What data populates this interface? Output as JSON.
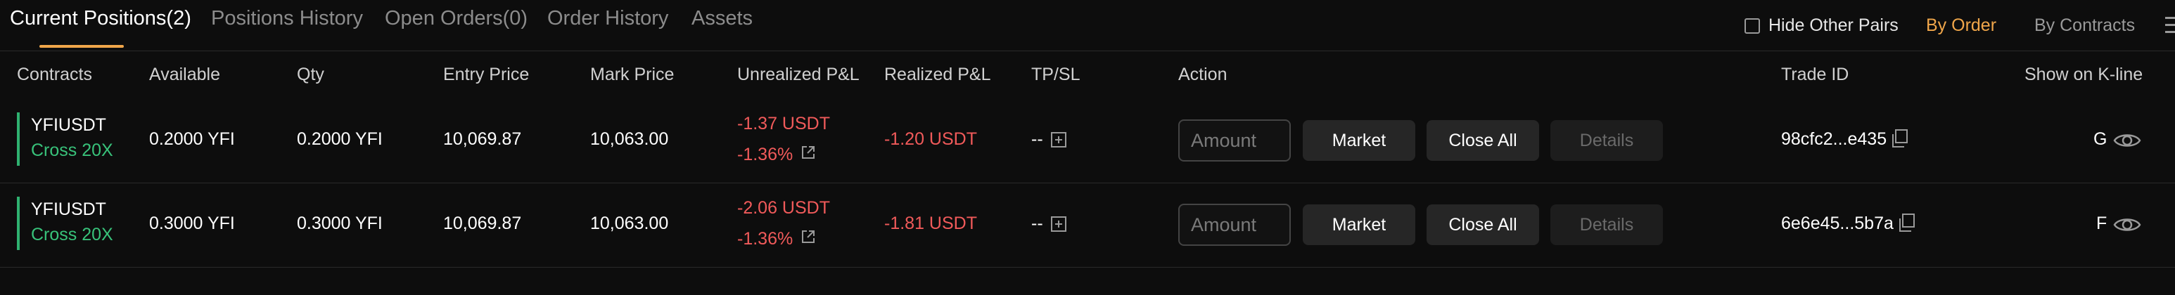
{
  "tabs": [
    {
      "label": "Current Positions(2)"
    },
    {
      "label": "Positions History"
    },
    {
      "label": "Open Orders(0)"
    },
    {
      "label": "Order History"
    },
    {
      "label": "Assets"
    }
  ],
  "top_right": {
    "hide_pairs_label": "Hide Other Pairs",
    "by_order_label": "By Order",
    "by_contracts_label": "By Contracts"
  },
  "columns": [
    "Contracts",
    "Available",
    "Qty",
    "Entry Price",
    "Mark Price",
    "Unrealized P&L",
    "Realized P&L",
    "TP/SL",
    "Action",
    "Trade ID",
    "Show on K-line"
  ],
  "rows": [
    {
      "contract": "YFIUSDT",
      "margin": "Cross 20X",
      "available": "0.2000 YFI",
      "qty": "0.2000 YFI",
      "entry_price": "10,069.87",
      "mark_price": "10,063.00",
      "unrealized_value": "-1.37 USDT",
      "unrealized_pct": "-1.36%",
      "realized": "-1.20 USDT",
      "tpsl": "--",
      "amount_placeholder": "Amount",
      "market_label": "Market",
      "close_all_label": "Close All",
      "details_label": "Details",
      "trade_id": "98cfc2...e435",
      "kline_label": "G"
    },
    {
      "contract": "YFIUSDT",
      "margin": "Cross 20X",
      "available": "0.3000 YFI",
      "qty": "0.3000 YFI",
      "entry_price": "10,069.87",
      "mark_price": "10,063.00",
      "unrealized_value": "-2.06 USDT",
      "unrealized_pct": "-1.36%",
      "realized": "-1.81 USDT",
      "tpsl": "--",
      "amount_placeholder": "Amount",
      "market_label": "Market",
      "close_all_label": "Close All",
      "details_label": "Details",
      "trade_id": "6e6e45...5b7a",
      "kline_label": "F"
    }
  ],
  "colors": {
    "accent": "#f0a64a",
    "loss": "#f05a5a",
    "cross_margin": "#38c27a",
    "background": "#0d0d0d"
  },
  "icons": [
    "checkbox-icon",
    "more-icon",
    "external-link-icon",
    "add-tpsl-icon",
    "copy-icon",
    "eye-icon"
  ]
}
